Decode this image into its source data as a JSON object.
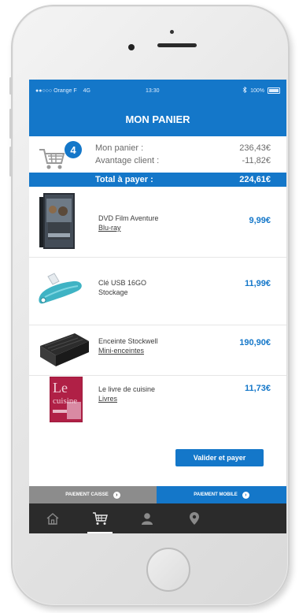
{
  "status_bar": {
    "carrier": "●●○○○ Orange F",
    "network": "4G",
    "time": "13:30",
    "bluetooth_icon": "bluetooth-icon",
    "battery": "100%"
  },
  "header": {
    "title": "MON PANIER"
  },
  "cart_summary": {
    "cart_icon": "shopping-cart-icon",
    "count": "4",
    "subtotal_label": "Mon panier :",
    "subtotal_value": "236,43€",
    "discount_label": "Avantage client :",
    "discount_value": "-11,82€",
    "total_label": "Total à payer :",
    "total_value": "224,61€"
  },
  "items": [
    {
      "name": "DVD Film Aventure",
      "category": "Blu-ray",
      "price": "9,99€"
    },
    {
      "name": "Clé USB 16GO",
      "category": "Stockage",
      "price": "11,99€"
    },
    {
      "name": "Enceinte Stockwell",
      "category": "Mini-enceintes",
      "price": "190,90€"
    },
    {
      "name": "Le livre de cuisine",
      "category": "Livres",
      "price": "11,73€"
    }
  ],
  "book_cover_text": {
    "title": "Le",
    "subtitle": "cuisine"
  },
  "validate_button": "Valider et payer",
  "payment": {
    "caisse_label": "PAIEMENT CAISSE",
    "mobile_label": "PAIEMENT MOBILE"
  },
  "tabs": [
    {
      "icon": "home-icon",
      "active": false
    },
    {
      "icon": "cart-icon",
      "active": true
    },
    {
      "icon": "user-icon",
      "active": false
    },
    {
      "icon": "location-pin-icon",
      "active": false
    }
  ],
  "colors": {
    "accent": "#1477c9",
    "price": "#1477c9",
    "tabbar": "#2b2b2b",
    "caisse": "#8c8c8c"
  }
}
